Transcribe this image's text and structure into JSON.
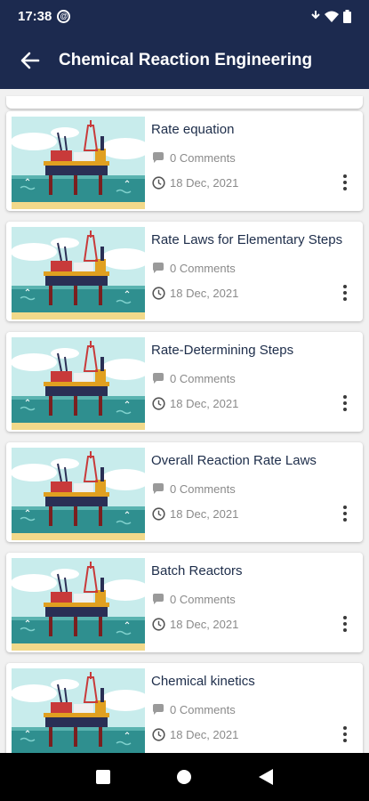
{
  "status_bar": {
    "time": "17:38",
    "at_symbol": "@"
  },
  "app_bar": {
    "title": "Chemical Reaction Engineering",
    "back_icon": "arrow-back-icon"
  },
  "colors": {
    "primary": "#1c2a4f",
    "title_text": "#1d2d4a",
    "meta_text": "#8a8a8a"
  },
  "posts": [
    {
      "title": "Rate equation",
      "comments": "0 Comments",
      "date": "18 Dec, 2021"
    },
    {
      "title": "Rate Laws for Elementary Steps",
      "comments": "0 Comments",
      "date": "18 Dec, 2021"
    },
    {
      "title": "Rate-Determining Steps",
      "comments": "0 Comments",
      "date": "18 Dec, 2021"
    },
    {
      "title": "Overall Reaction Rate Laws",
      "comments": "0 Comments",
      "date": "18 Dec, 2021"
    },
    {
      "title": "Batch Reactors",
      "comments": "0 Comments",
      "date": "18 Dec, 2021"
    },
    {
      "title": "Chemical kinetics",
      "comments": "0 Comments",
      "date": "18 Dec, 2021"
    }
  ]
}
